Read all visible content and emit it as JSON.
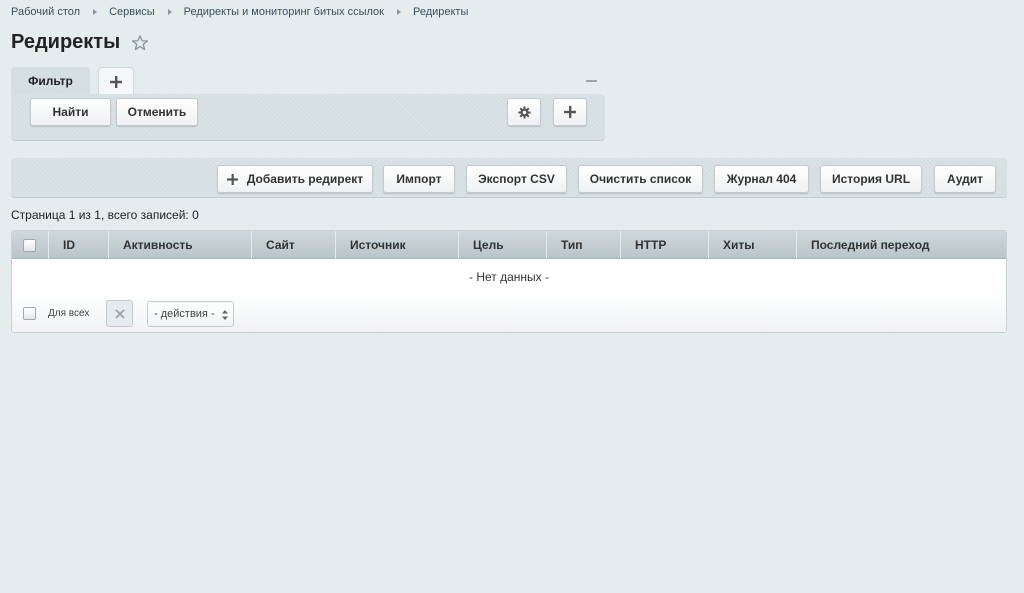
{
  "breadcrumb": [
    {
      "label": "Рабочий стол"
    },
    {
      "label": "Сервисы"
    },
    {
      "label": "Редиректы и мониторинг битых ссылок"
    },
    {
      "label": "Редиректы"
    }
  ],
  "page": {
    "title": "Редиректы",
    "star_icon": "star-icon"
  },
  "filter": {
    "tab_label": "Фильтр",
    "find_label": "Найти",
    "cancel_label": "Отменить",
    "settings_icon": "gear-icon",
    "add_icon": "plus-icon"
  },
  "toolbar": {
    "add_redirect_label": "Добавить редирект",
    "import_label": "Импорт",
    "export_csv_label": "Экспорт CSV",
    "clear_list_label": "Очистить список",
    "journal_404_label": "Журнал 404",
    "url_history_label": "История URL",
    "audit_label": "Аудит"
  },
  "page_info": "Страница 1 из 1, всего записей: 0",
  "grid": {
    "columns": [
      "ID",
      "Активность",
      "Сайт",
      "Источник",
      "Цель",
      "Тип",
      "HTTP",
      "Хиты",
      "Последний переход"
    ],
    "empty_text": "- Нет данных -",
    "footer": {
      "for_all_label": "Для всех",
      "actions_selected": "- действия -"
    }
  },
  "colors": {
    "background": "#e5ecee",
    "panel": "#d5dee1",
    "header": "#c4ced2"
  }
}
